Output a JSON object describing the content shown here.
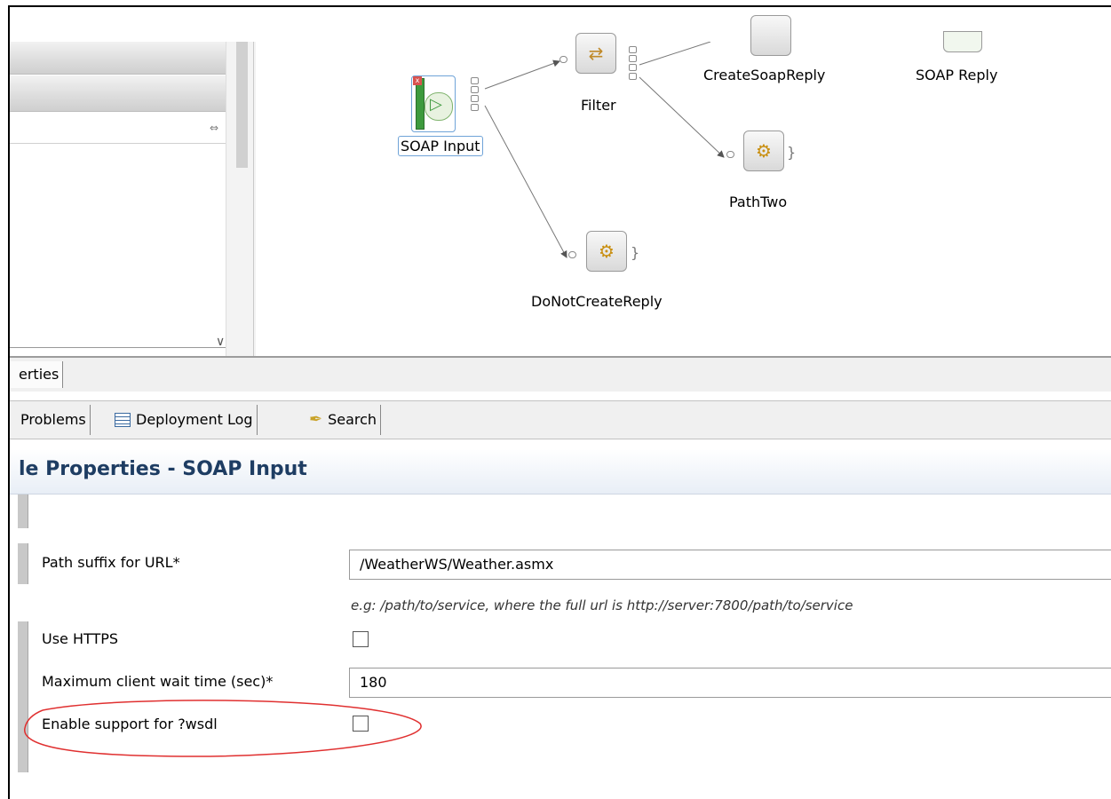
{
  "window": {
    "top_link_text": "..p"
  },
  "canvas": {
    "nodes": {
      "soap_input": "SOAP Input",
      "filter": "Filter",
      "create_soap_reply": "CreateSoapReply",
      "soap_reply": "SOAP Reply",
      "path_two": "PathTwo",
      "do_not_create_reply": "DoNotCreateReply"
    }
  },
  "properties_bar": {
    "tab_label": "erties"
  },
  "bottom_tabs": [
    {
      "label": "Problems",
      "icon": "problems-icon"
    },
    {
      "label": "Deployment Log",
      "icon": "table-icon"
    },
    {
      "label": "Search",
      "icon": "flashlight-icon"
    }
  ],
  "properties": {
    "title": "le Properties - SOAP Input",
    "path_suffix": {
      "label": "Path suffix for URL*",
      "value": "/WeatherWS/Weather.asmx",
      "hint": "e.g: /path/to/service, where the full url is http://server:7800/path/to/service"
    },
    "use_https": {
      "label": "Use HTTPS",
      "checked": false
    },
    "max_wait": {
      "label": "Maximum client wait time (sec)*",
      "value": "180"
    },
    "wsdl": {
      "label": "Enable support for ?wsdl",
      "checked": false
    }
  },
  "annotation": {
    "color": "#e03030"
  }
}
